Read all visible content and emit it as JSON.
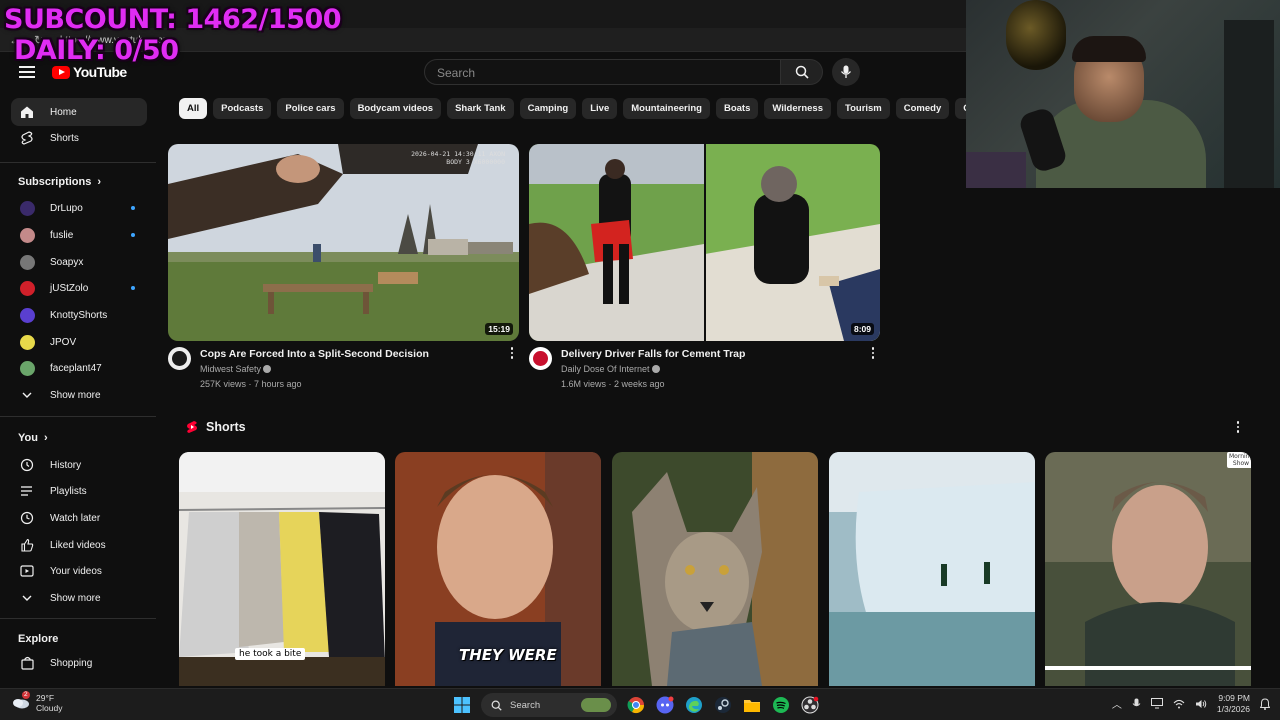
{
  "overlay": {
    "subcount": "SUBCOUNT: 1462/1500",
    "daily": "DAILY: 0/50"
  },
  "browser": {
    "url": "https://www.youtube.com"
  },
  "header": {
    "logo": "YouTube",
    "search_placeholder": "Search"
  },
  "sidebar": {
    "home": "Home",
    "shorts": "Shorts",
    "subscriptions_head": "Subscriptions",
    "subscriptions": [
      {
        "name": "DrLupo",
        "color": "#3a2a6a",
        "live": true
      },
      {
        "name": "fuslie",
        "color": "#c48a8a",
        "live": true
      },
      {
        "name": "Soapyx",
        "color": "#777777",
        "live": false
      },
      {
        "name": "jUStZolo",
        "color": "#d0202a",
        "live": true
      },
      {
        "name": "KnottyShorts",
        "color": "#5a3fd0",
        "live": false
      },
      {
        "name": "JPOV",
        "color": "#e7d94a",
        "live": false
      },
      {
        "name": "faceplant47",
        "color": "#6aa56a",
        "live": false
      }
    ],
    "show_more_1": "Show more",
    "you_head": "You",
    "you_items": [
      "History",
      "Playlists",
      "Watch later",
      "Liked videos",
      "Your videos"
    ],
    "show_more_2": "Show more",
    "explore_head": "Explore",
    "explore_items": [
      "Shopping"
    ]
  },
  "chips": [
    "All",
    "Podcasts",
    "Police cars",
    "Bodycam videos",
    "Shark Tank",
    "Camping",
    "Live",
    "Mountaineering",
    "Boats",
    "Wilderness",
    "Tourism",
    "Comedy",
    "Cars"
  ],
  "videos": [
    {
      "title": "Cops Are Forced Into a Split-Second Decision",
      "channel": "Midwest Safety",
      "stats": "257K views · 7 hours ago",
      "duration": "15:19",
      "bodycam_text": "2026-04-21 14:30:11 AXON BODY 3 X6000000"
    },
    {
      "title": "Delivery Driver Falls for Cement Trap",
      "channel": "Daily Dose Of Internet",
      "stats": "1.6M views · 2 weeks ago",
      "duration": "8:09"
    }
  ],
  "shorts": {
    "heading": "Shorts",
    "captions": [
      "he took a bite",
      "THEY WERE",
      "",
      "",
      ""
    ],
    "badge": "Morning Show"
  },
  "taskbar": {
    "weather_temp": "29°F",
    "weather_desc": "Cloudy",
    "weather_badge": "2",
    "search": "Search",
    "time": "9:09 PM",
    "date": "1/3/2026"
  }
}
